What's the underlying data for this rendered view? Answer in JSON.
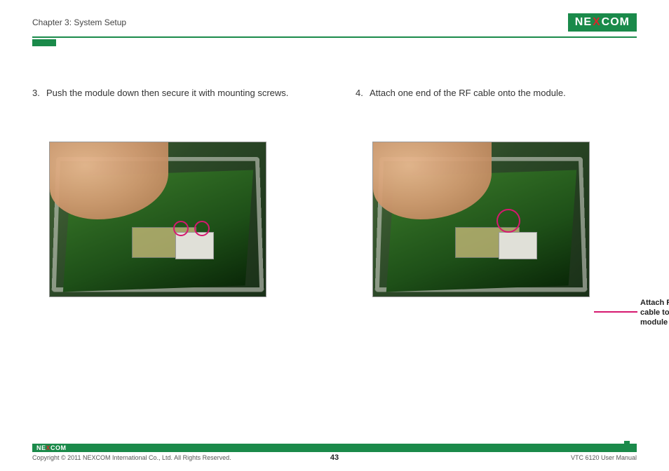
{
  "header": {
    "chapter": "Chapter 3: System Setup",
    "logo_text_pre": "NE",
    "logo_text_x": "X",
    "logo_text_post": "COM"
  },
  "steps": {
    "left": {
      "num": "3.",
      "text": "Push the module down then secure it with mounting screws."
    },
    "right": {
      "num": "4.",
      "text": "Attach one end of the RF cable onto the module."
    }
  },
  "callout": {
    "text": "Attach RF cable to the module"
  },
  "footer": {
    "logo_pre": "NE",
    "logo_x": "X",
    "logo_post": "COM",
    "copyright": "Copyright © 2011 NEXCOM International Co., Ltd. All Rights Reserved.",
    "page_number": "43",
    "doc_title": "VTC 6120 User Manual"
  }
}
